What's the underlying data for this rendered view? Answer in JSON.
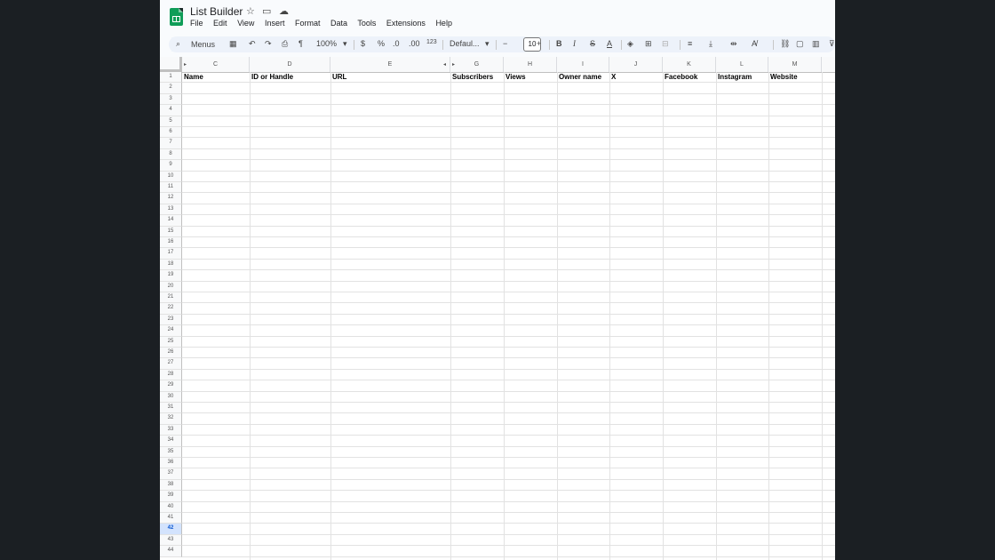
{
  "app": {
    "title": "List Builder",
    "menu": [
      "File",
      "Edit",
      "View",
      "Insert",
      "Format",
      "Data",
      "Tools",
      "Extensions",
      "Help"
    ],
    "title_icons": [
      "star-icon",
      "move-to-folder-icon",
      "cloud-saved-icon"
    ]
  },
  "toolbar": {
    "search_placeholder": "Menus",
    "zoom": "100%",
    "currency": "$",
    "percent": "%",
    "decrease_decimal": ".0",
    "increase_decimal": ".00",
    "number_format": "123",
    "font": "Defaul...",
    "font_size": "10",
    "bold": "B",
    "italic": "I",
    "strike": "S",
    "text_color": "A"
  },
  "sheet": {
    "column_letters": [
      "C",
      "D",
      "E",
      "G",
      "H",
      "I",
      "J",
      "K",
      "L",
      "M"
    ],
    "header_row": [
      "Name",
      "ID or Handle",
      "URL",
      "Subscribers",
      "Views",
      "Owner name",
      "X",
      "Facebook",
      "Instagram",
      "Website"
    ],
    "row_numbers": [
      "1",
      "2",
      "3",
      "4",
      "5",
      "6",
      "7",
      "8",
      "9",
      "10",
      "11",
      "12",
      "13",
      "14",
      "15",
      "16",
      "17",
      "18",
      "19",
      "20",
      "21",
      "22",
      "23",
      "24",
      "25",
      "26",
      "27",
      "28",
      "29",
      "30",
      "31",
      "32",
      "33",
      "34",
      "35",
      "36",
      "37",
      "38",
      "39",
      "40",
      "41",
      "42",
      "43",
      "44"
    ],
    "selected_row": "42"
  },
  "colors": {
    "logo_green": "#0f9d58",
    "toolbar_bg": "#edf2fa",
    "selected_row_bg": "#d3e3fd",
    "selected_row_text": "#0b57d0"
  }
}
